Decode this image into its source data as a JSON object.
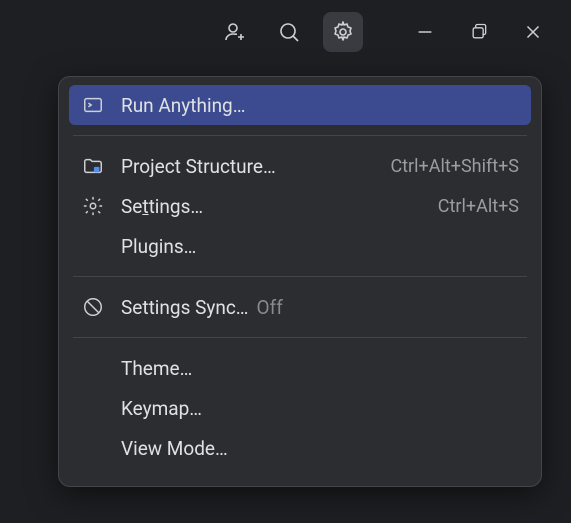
{
  "toolbar": {
    "icons": {
      "user_add": "user-add-icon",
      "search": "search-icon",
      "gear": "gear-icon",
      "minimize": "minimize-icon",
      "restore": "restore-icon",
      "close": "close-icon"
    }
  },
  "menu": {
    "items": [
      {
        "icon": "terminal-icon",
        "label": "Run Anything…",
        "shortcut": "",
        "selected": true
      },
      {
        "separator": true
      },
      {
        "icon": "project-icon",
        "label": "Project Structure…",
        "shortcut": "Ctrl+Alt+Shift+S"
      },
      {
        "icon": "gear-icon",
        "label_prefix": "Se",
        "label_underlined": "t",
        "label_suffix": "tings…",
        "shortcut": "Ctrl+Alt+S"
      },
      {
        "icon": "",
        "label": "Plugins…",
        "shortcut": ""
      },
      {
        "separator": true
      },
      {
        "icon": "sync-off-icon",
        "label": "Settings Sync…",
        "status": "Off",
        "shortcut": ""
      },
      {
        "separator": true
      },
      {
        "icon": "",
        "label": "Theme…",
        "shortcut": ""
      },
      {
        "icon": "",
        "label": "Keymap…",
        "shortcut": ""
      },
      {
        "icon": "",
        "label": "View Mode…",
        "shortcut": ""
      }
    ]
  },
  "edge": {
    "colors": [
      "#0b0b0b",
      "#6b6bff",
      "#3a9cf0",
      "#e85454"
    ]
  }
}
